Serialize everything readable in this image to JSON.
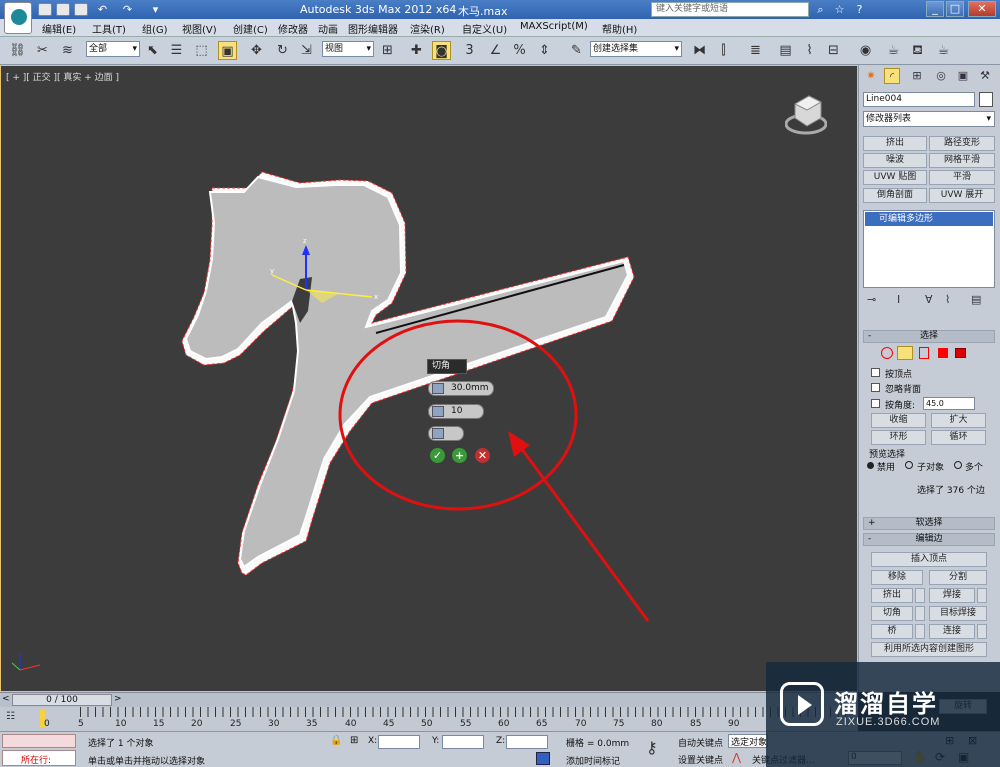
{
  "titlebar": {
    "app_title": "Autodesk 3ds Max  2012 x64",
    "file_name": "木马.max",
    "search_placeholder": "键入关键字或短语"
  },
  "menu": [
    "编辑(E)",
    "工具(T)",
    "组(G)",
    "视图(V)",
    "创建(C)",
    "修改器",
    "动画",
    "图形编辑器",
    "渲染(R)",
    "自定义(U)",
    "MAXScript(M)",
    "帮助(H)"
  ],
  "toolbar": {
    "selection_filter": "全部",
    "ref_coord": "视图",
    "named_selection": "创建选择集"
  },
  "viewport": {
    "label": "[ + ][ 正交 ][ 真实 + 边面 ]",
    "caddy": {
      "title": "切角",
      "amount": "30.0mm",
      "segments": "10"
    }
  },
  "command_panel": {
    "object_name": "Line004",
    "modifier_list": "修改器列表",
    "modifier_buttons": [
      "挤出",
      "路径变形",
      "噪波",
      "网格平滑",
      "UVW 贴图",
      "平滑",
      "倒角剖面",
      "UVW 展开"
    ],
    "stack_item": "可编辑多边形",
    "selection": {
      "header": "选择",
      "by_vertex": "按顶点",
      "ignore_backfacing": "忽略背面",
      "by_angle": "按角度:",
      "angle_value": "45.0",
      "shrink": "收缩",
      "grow": "扩大",
      "ring": "环形",
      "loop": "循环",
      "preview_label": "预览选择",
      "preview_options": [
        "禁用",
        "子对象",
        "多个"
      ],
      "status": "选择了 376 个边"
    },
    "soft_selection": "软选择",
    "edit_edges": {
      "header": "编辑边",
      "insert_vertex": "插入顶点",
      "remove": "移除",
      "split": "分割",
      "extrude": "挤出",
      "weld": "焊接",
      "chamfer": "切角",
      "target_weld": "目标焊接",
      "bridge": "桥",
      "connect": "连接",
      "create_shape": "利用所选内容创建图形",
      "rotate": "旋转"
    }
  },
  "timeline": {
    "frame_counter": "0 / 100",
    "ticks": [
      "0",
      "5",
      "10",
      "15",
      "20",
      "25",
      "30",
      "35",
      "40",
      "45",
      "50",
      "55",
      "60",
      "65",
      "70",
      "75",
      "80",
      "85",
      "90"
    ]
  },
  "status_bar": {
    "running_label": "所在行:",
    "selection_status": "选择了 1 个对象",
    "prompt": "单击或单击并拖动以选择对象",
    "x_label": "X:",
    "y_label": "Y:",
    "z_label": "Z:",
    "grid": "栅格 = 0.0mm",
    "add_time_tag": "添加时间标记",
    "auto_key": "自动关键点",
    "selected": "选定对象",
    "set_key": "设置关键点",
    "key_filters": "关键点过滤器...",
    "frame_field": "0"
  },
  "watermark": {
    "title": "溜溜自学",
    "url": "ZIXUE.3D66.COM"
  },
  "colors": {
    "accent_yellow": "#f8e07a",
    "selection_blue": "#3c6ec0",
    "annotation_red": "#e01010",
    "edge_red": "#ff4040"
  }
}
